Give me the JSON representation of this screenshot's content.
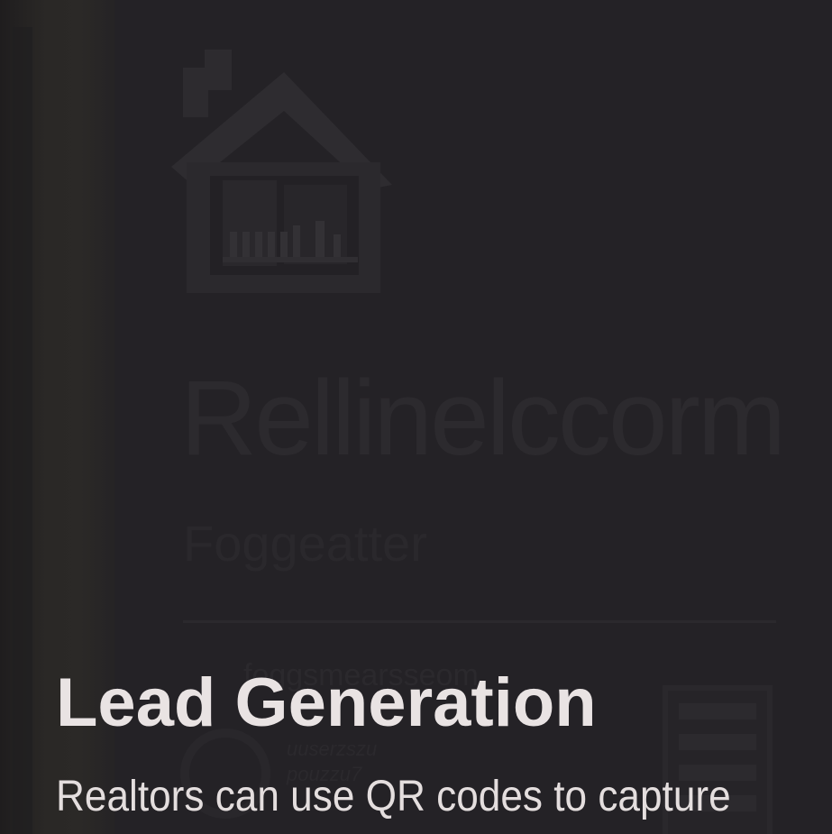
{
  "slide": {
    "headline": "Lead Generation",
    "body": "Realtors can use QR codes to capture"
  },
  "background": {
    "house_icon": "house-icon",
    "faint_title": "Rellinelccorm",
    "faint_subtitle": "Foggeatter",
    "faint_row": "foggsmearsseom",
    "faint_small_1": "uuserzszu",
    "faint_small_2": "pouzzu7"
  },
  "colors": {
    "background": "#242226",
    "headline": "#e9e3e3",
    "body": "#e4dede"
  }
}
